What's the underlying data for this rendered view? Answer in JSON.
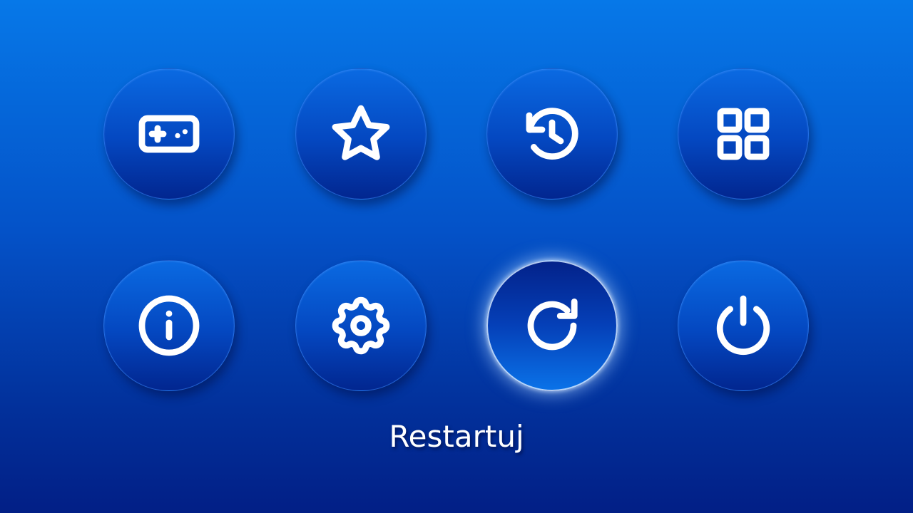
{
  "menu": {
    "items": [
      {
        "id": "games",
        "icon": "gamepad-icon"
      },
      {
        "id": "favorites",
        "icon": "star-icon"
      },
      {
        "id": "history",
        "icon": "history-icon"
      },
      {
        "id": "apps",
        "icon": "grid-icon"
      },
      {
        "id": "info",
        "icon": "info-icon"
      },
      {
        "id": "settings",
        "icon": "gear-icon"
      },
      {
        "id": "restart",
        "icon": "restart-icon",
        "selected": true
      },
      {
        "id": "power",
        "icon": "power-icon"
      }
    ],
    "selected_label": "Restartuj"
  },
  "colors": {
    "background_top": "#0678e8",
    "background_bottom": "#021f86",
    "icon": "#ffffff",
    "selected_glow": "#aad2ff"
  }
}
